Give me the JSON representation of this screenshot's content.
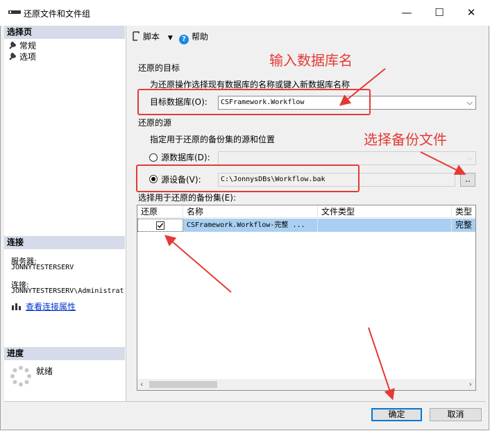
{
  "window": {
    "title": "还原文件和文件组",
    "minimize": "—",
    "maximize": "☐",
    "close": "✕"
  },
  "left": {
    "select_page_header": "选择页",
    "pages": [
      "常规",
      "选项"
    ],
    "connection_header": "连接",
    "server_label": "服务器:",
    "server_value": "JONNYTESTERSERV",
    "connection_label": "连接:",
    "connection_value": "JONNYTESTERSERV\\Administrat",
    "view_props_link": "查看连接属性",
    "progress_header": "进度",
    "progress_status": "就绪"
  },
  "toolbar": {
    "script_label": "脚本",
    "help_label": "帮助"
  },
  "destination": {
    "section_title": "还原的目标",
    "hint": "为还原操作选择现有数据库的名称或键入新数据库名称",
    "target_db_label": "目标数据库(O):",
    "target_db_value": "CSFramework.Workflow"
  },
  "source": {
    "section_title": "还原的源",
    "hint": "指定用于还原的备份集的源和位置",
    "from_db_label": "源数据库(D):",
    "from_device_label": "源设备(V):",
    "device_path": "C:\\JonnysDBs\\Workflow.bak",
    "browse_label": "..",
    "selected_option": "源设备(V):"
  },
  "backup_sets": {
    "label": "选择用于还原的备份集(E):",
    "columns": [
      "还原",
      "名称",
      "文件类型",
      "类型"
    ],
    "rows": [
      {
        "restore_checked": true,
        "name": "CSFramework.Workflow-完整 ...",
        "file_type": "",
        "type": "完整"
      }
    ]
  },
  "annotations": {
    "enter_db_name": "输入数据库名",
    "choose_backup_file": "选择备份文件"
  },
  "buttons": {
    "ok": "确定",
    "cancel": "取消"
  },
  "colors": {
    "annotation_red": "#e53935",
    "selected_row": "#a9cff2",
    "section_header": "#d6dbe9",
    "link": "#0033cc",
    "help_icon": "#1e88e5"
  }
}
